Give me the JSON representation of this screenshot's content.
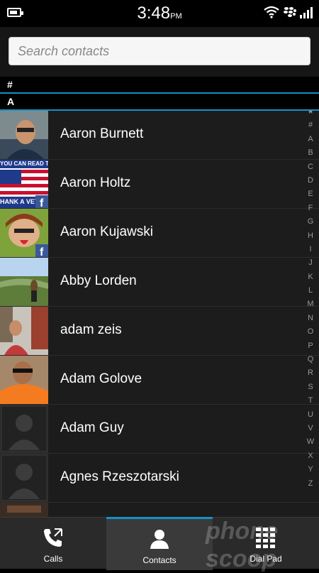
{
  "status": {
    "time": "3:48",
    "ampm": "PM",
    "icons": [
      "battery-icon",
      "wifi-icon",
      "blackberry-icon",
      "signal-icon"
    ]
  },
  "search": {
    "placeholder": "Search contacts"
  },
  "sections": {
    "hash": "#",
    "a": "A"
  },
  "contacts": [
    {
      "name": "Aaron Burnett",
      "avatar": "photo"
    },
    {
      "name": "Aaron Holtz",
      "avatar": "flag-photo",
      "badge": "f"
    },
    {
      "name": "Aaron Kujawski",
      "avatar": "photo",
      "badge": "f"
    },
    {
      "name": "Abby Lorden",
      "avatar": "landscape-photo"
    },
    {
      "name": "adam zeis",
      "avatar": "street-photo"
    },
    {
      "name": "Adam Golove",
      "avatar": "orange-shirt-photo"
    },
    {
      "name": "Adam Guy",
      "avatar": "placeholder"
    },
    {
      "name": "Agnes Rzeszotarski",
      "avatar": "placeholder"
    }
  ],
  "flag_text": {
    "top": "YOU CAN READ TH",
    "bottom": "HANK A VET"
  },
  "index": [
    "★",
    "#",
    "A",
    "B",
    "C",
    "D",
    "E",
    "F",
    "G",
    "H",
    "I",
    "J",
    "K",
    "L",
    "M",
    "N",
    "O",
    "P",
    "Q",
    "R",
    "S",
    "T",
    "U",
    "V",
    "W",
    "X",
    "Y",
    "Z"
  ],
  "nav": {
    "calls": "Calls",
    "contacts": "Contacts",
    "dialpad": "Dial Pad"
  },
  "watermark": "phone scoop",
  "colors": {
    "accent": "#1591c8",
    "facebook": "#3b5998"
  }
}
